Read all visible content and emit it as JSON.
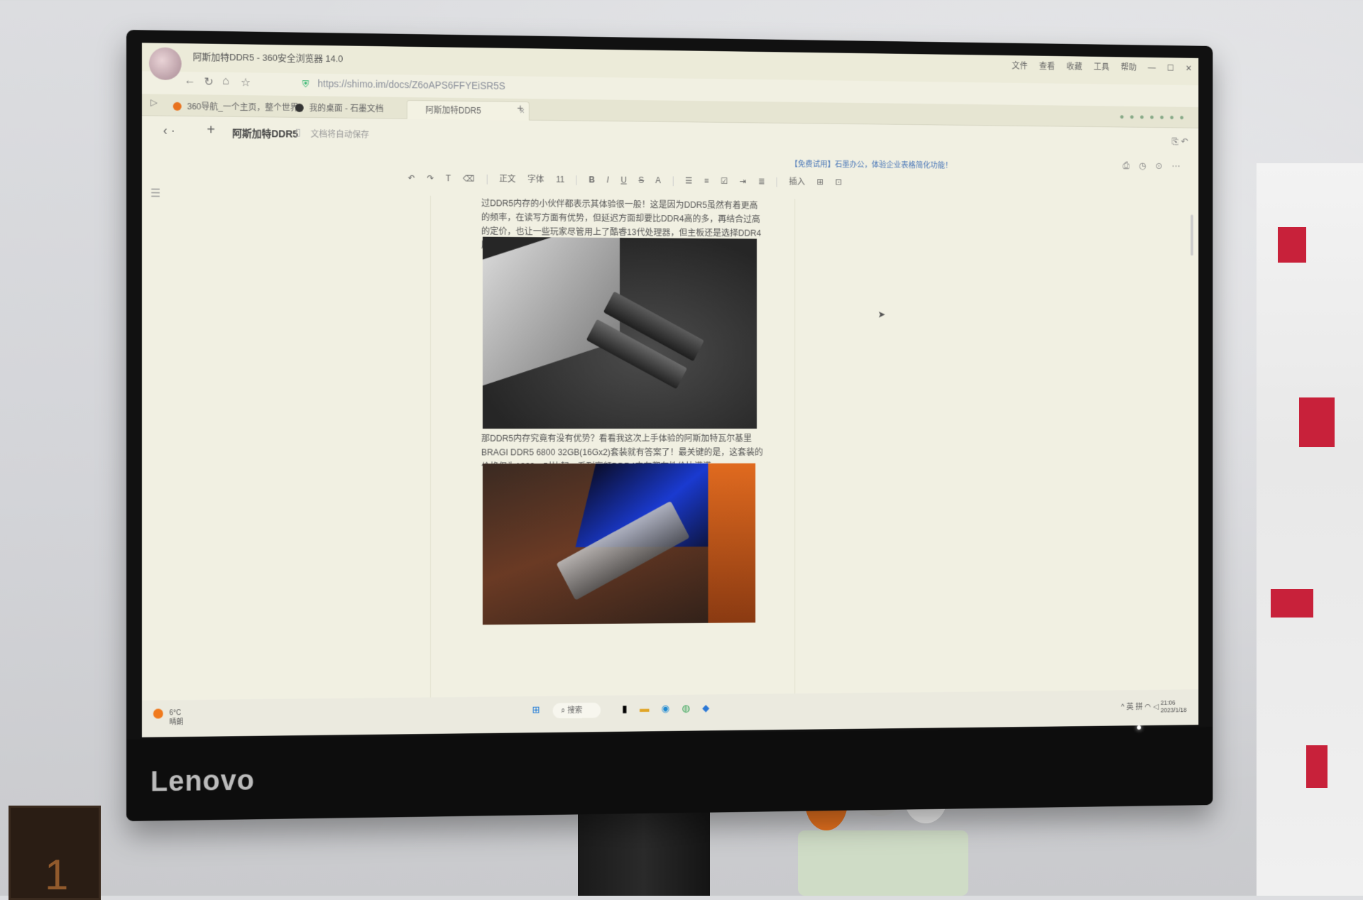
{
  "browser": {
    "window_title": "阿斯加特DDR5 - 360安全浏览器 14.0",
    "url": "https://shimo.im/docs/Z6oAPS6FFYEiSR5S",
    "menu": [
      "文件",
      "查看",
      "收藏",
      "工具",
      "帮助"
    ],
    "tabs": [
      {
        "label": "360导航_一个主页，整个世界",
        "active": false
      },
      {
        "label": "我的桌面 - 石墨文档",
        "active": false
      },
      {
        "label": "阿斯加特DDR5",
        "active": true
      }
    ],
    "new_tab": "+"
  },
  "doc": {
    "title": "阿斯加特DDR5",
    "save_status": "文档将自动保存",
    "promo": "【免费试用】石墨办公，体验企业表格简化功能！",
    "toolbar": [
      "正文",
      "字体",
      "11",
      "B",
      "I",
      "U",
      "S",
      "A",
      "插入"
    ],
    "paragraph1": "过DDR5内存的小伙伴都表示其体验很一般！这是因为DDR5虽然有着更高的频率，在读写方面有优势，但延迟方面却要比DDR4高的多，再结合过高的定价，也让一些玩家尽管用上了酷睿13代处理器，但主板还是选择DDR4版本。",
    "paragraph2": "那DDR5内存究竟有没有优势？看看我这次上手体验的阿斯加特瓦尔基里BRAGI DDR5 6800 32GB(16Gx2)套装就有答案了！最关键的是，这套装的价格仅为1399，对比起一系列高频DDR4内存都有性价比满满。",
    "image1_alt": "motherboard with two DDR5 RAM sticks on dark felt",
    "image2_alt": "DDR5 RAM sticks resting on a laptop keyboard"
  },
  "taskbar": {
    "weather_temp": "6°C",
    "weather_desc": "晴朗",
    "search": "搜索",
    "tray": "21:06",
    "date": "2023/1/18",
    "ime": "英",
    "ime2": "拼"
  },
  "monitor": {
    "brand": "Lenovo"
  },
  "colors": {
    "screen_bg": "#f1f0e2",
    "link_blue": "#4a77b8",
    "secure_green": "#2db36b"
  }
}
